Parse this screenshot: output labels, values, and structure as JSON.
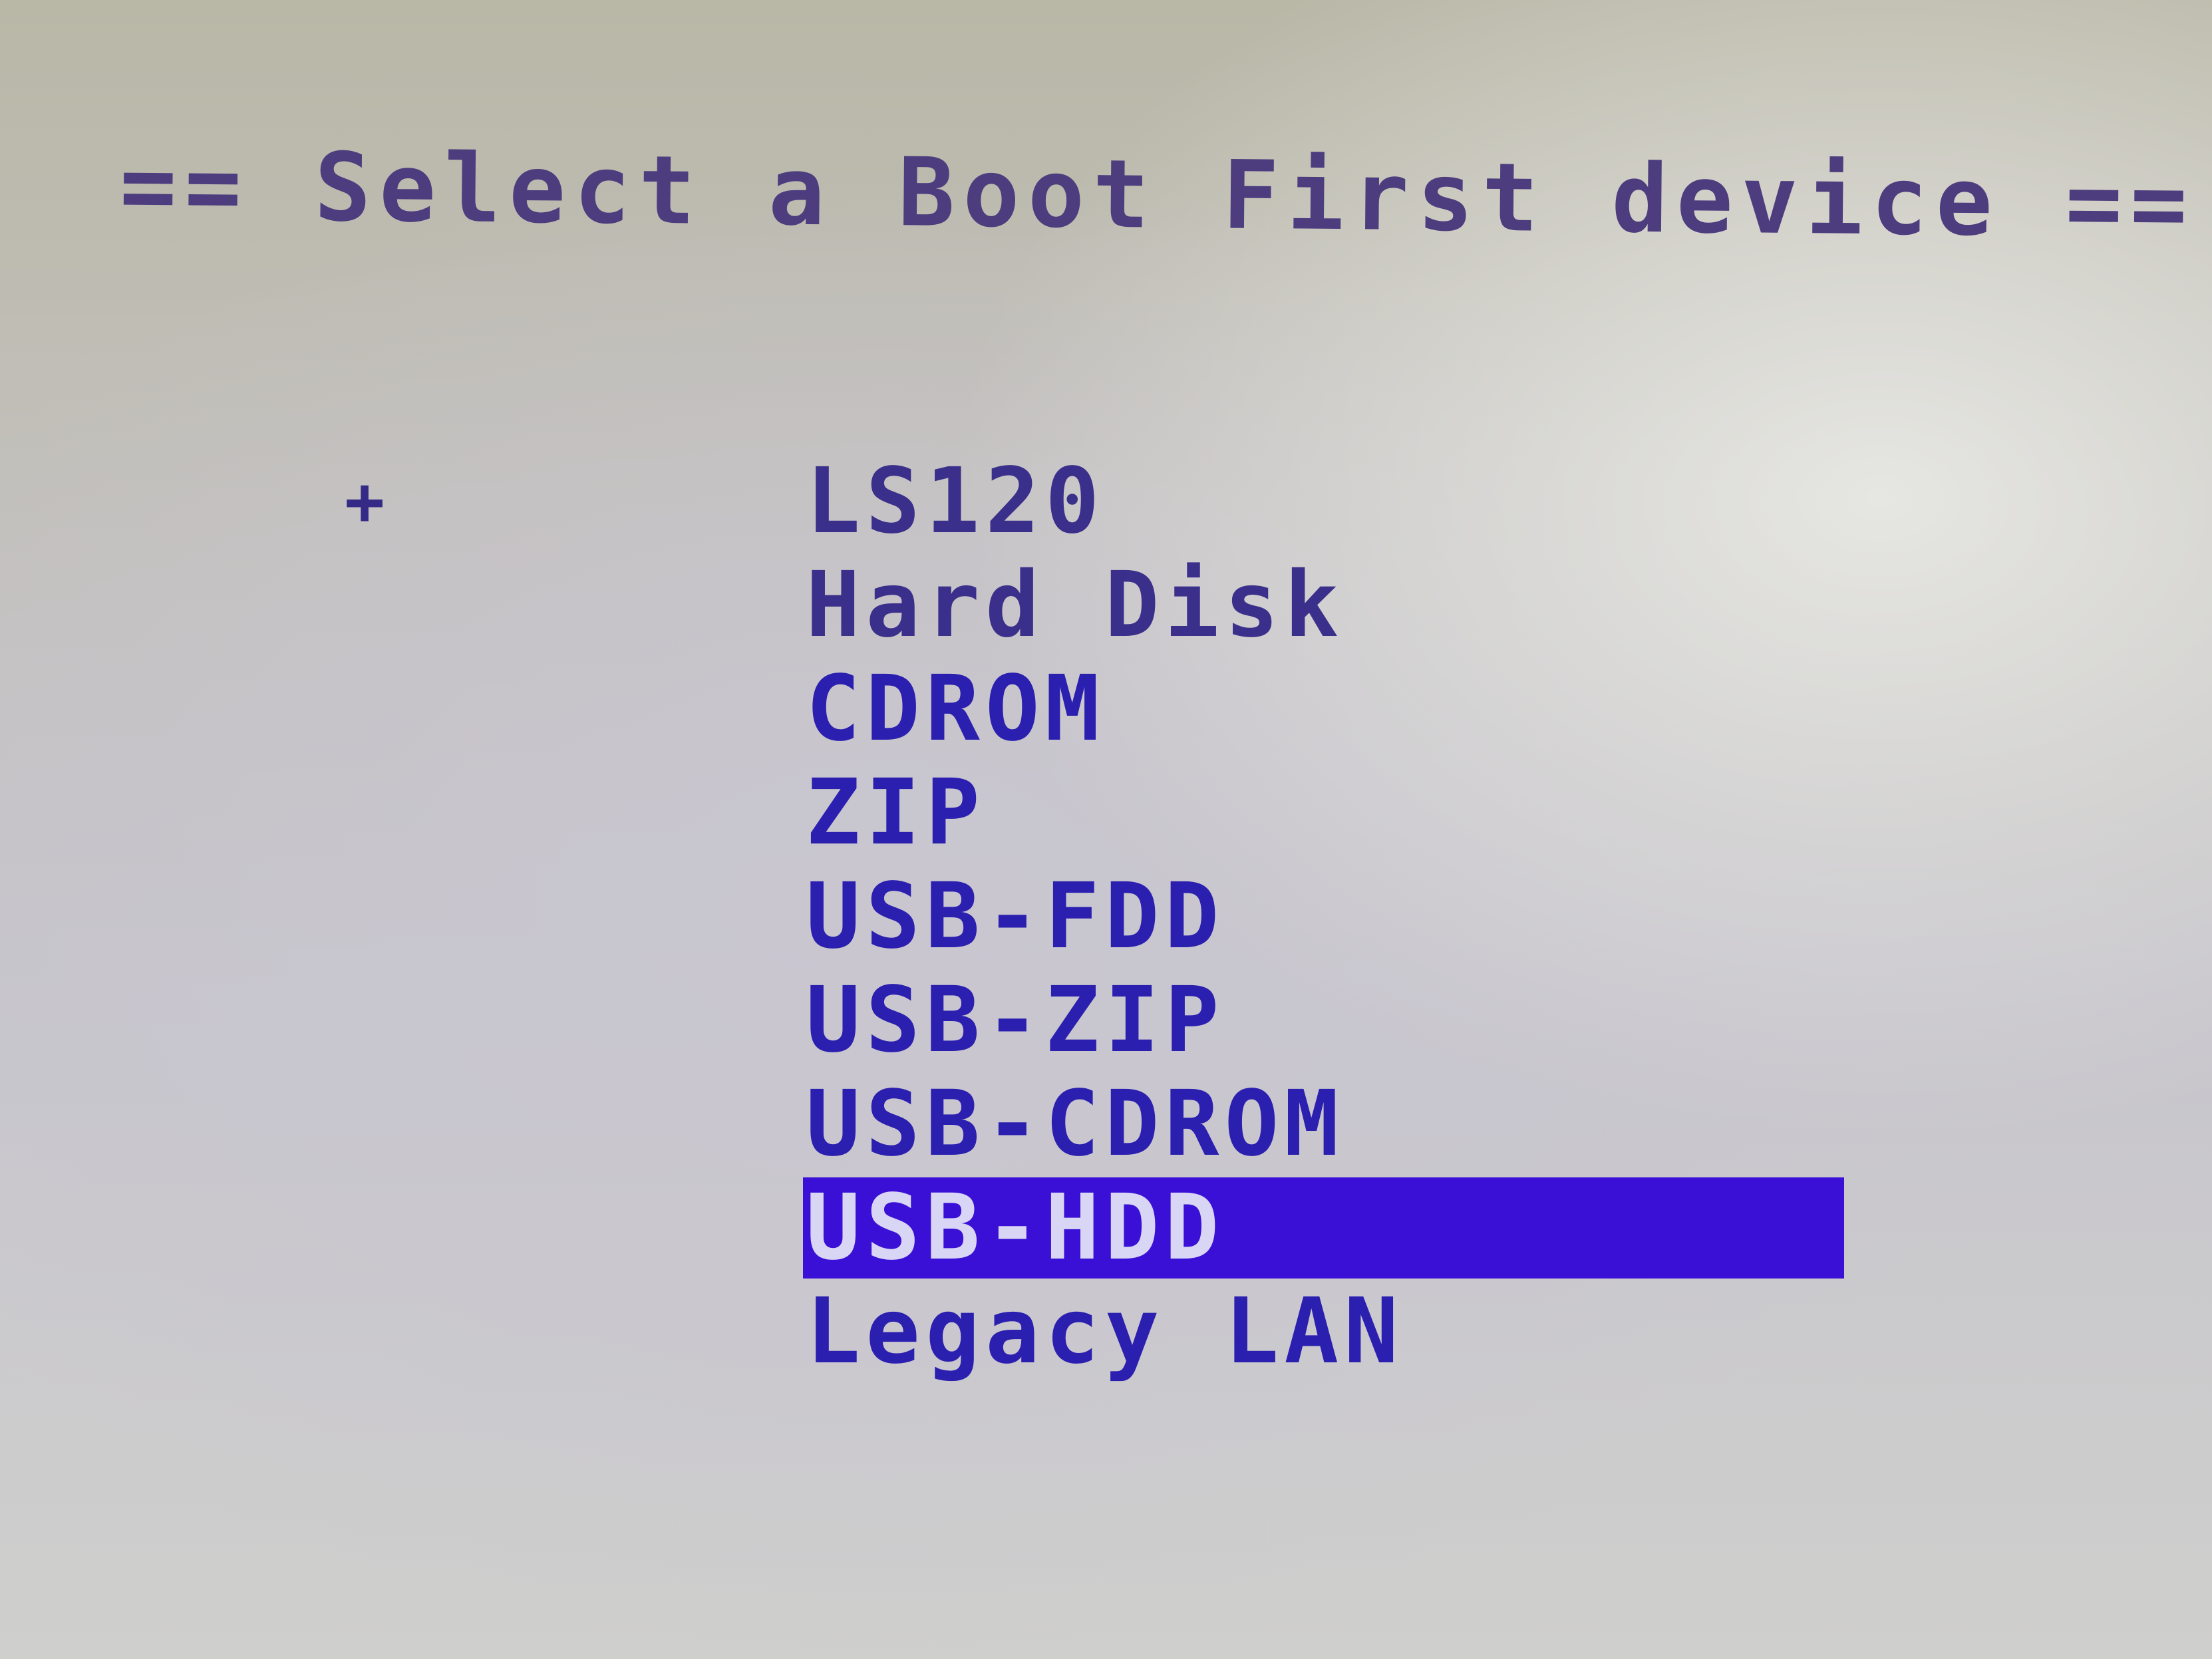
{
  "bios_screen": {
    "title": "== Select a Boot First device ==",
    "items": [
      {
        "label": "LS120",
        "marker": "",
        "selected": false
      },
      {
        "label": "Hard Disk",
        "marker": "+",
        "selected": false
      },
      {
        "label": "CDROM",
        "marker": "",
        "selected": false
      },
      {
        "label": "ZIP",
        "marker": "",
        "selected": false
      },
      {
        "label": "USB-FDD",
        "marker": "",
        "selected": false
      },
      {
        "label": "USB-ZIP",
        "marker": "",
        "selected": false
      },
      {
        "label": "USB-CDROM",
        "marker": "",
        "selected": false
      },
      {
        "label": "USB-HDD",
        "marker": "",
        "selected": true
      },
      {
        "label": "Legacy LAN",
        "marker": "",
        "selected": false
      }
    ],
    "colors": {
      "title_text": "#4d3d7e",
      "item_text": "#2b1fb0",
      "highlight_bg": "#3a10d6",
      "highlight_text": "#d8d6f4"
    }
  }
}
